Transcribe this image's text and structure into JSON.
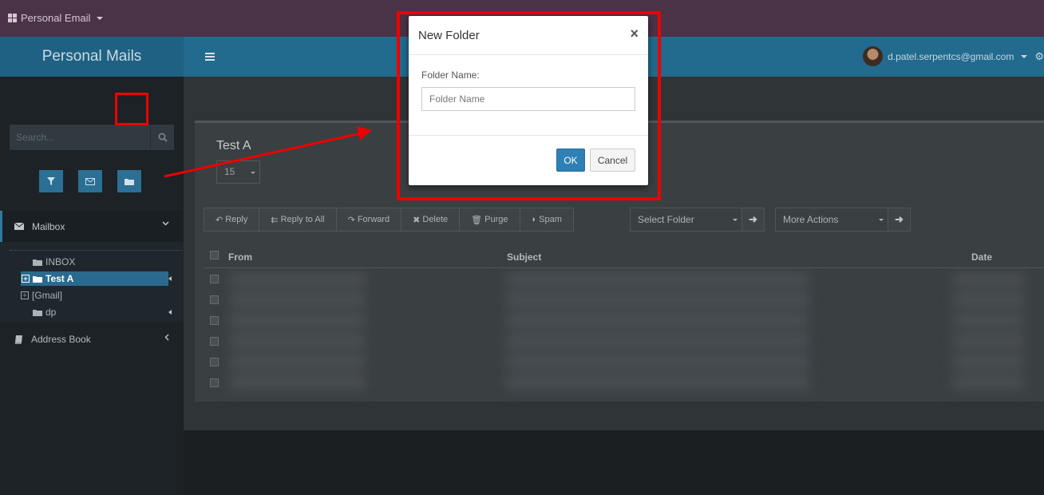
{
  "topbar": {
    "app_name": "Personal Email"
  },
  "header": {
    "brand": "Personal Mails",
    "user_email": "d.patel.serpentcs@gmail.com"
  },
  "sidebar": {
    "search_placeholder": "Search...",
    "mailbox_label": "Mailbox",
    "folders": [
      "INBOX",
      "Test A",
      "[Gmail]",
      "dp"
    ],
    "address_book_label": "Address Book"
  },
  "content": {
    "folder_title": "Test A",
    "page_size": "15",
    "actions": [
      "Reply",
      "Reply to All",
      "Forward",
      "Delete",
      "Purge",
      "Spam"
    ],
    "select_folder": "Select Folder",
    "more_actions": "More Actions",
    "columns": [
      "From",
      "Subject",
      "Date"
    ]
  },
  "modal": {
    "title": "New Folder",
    "close": "×",
    "field_label": "Folder Name:",
    "field_placeholder": "Folder Name",
    "ok_label": "OK",
    "cancel_label": "Cancel"
  },
  "colors": {
    "accent": "#2f80b4",
    "annotation": "#ee0000",
    "topbar": "#4a3247",
    "header": "#226a8e"
  }
}
